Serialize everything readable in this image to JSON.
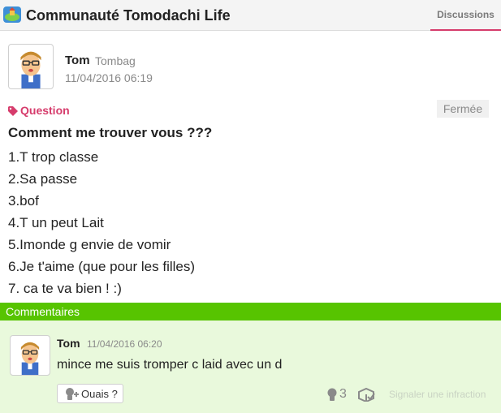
{
  "header": {
    "title": "Communauté Tomodachi Life",
    "tab_label": "Discussions"
  },
  "post": {
    "author_name": "Tom",
    "author_id": "Tombag",
    "timestamp": "11/04/2016 06:19",
    "topic_label": "Question",
    "status_label": "Fermée",
    "heading": "Comment me trouver vous ???",
    "lines": [
      "1.T trop classe",
      "2.Sa passe",
      "3.bof",
      "4.T un peut Lait",
      "5.Imonde g envie de vomir",
      "6.Je t'aime (que pour les filles)",
      "7. ca te va bien ! :)"
    ]
  },
  "comments": {
    "section_label": "Commentaires",
    "items": [
      {
        "author_name": "Tom",
        "timestamp": "11/04/2016 06:20",
        "text": "mince me suis tromper c laid avec un d",
        "yeah_label": "Ouais ?",
        "yeah_count": "3",
        "report_label": "Signaler une infraction"
      }
    ]
  },
  "colors": {
    "accent_pink": "#d63c6c",
    "comments_green": "#57c400",
    "comments_background": "#e9f9dc"
  },
  "icons": [
    "app-icon",
    "mii-avatar",
    "tag-icon",
    "yeah-icon",
    "yeah-count-icon",
    "spoiler-icon"
  ]
}
